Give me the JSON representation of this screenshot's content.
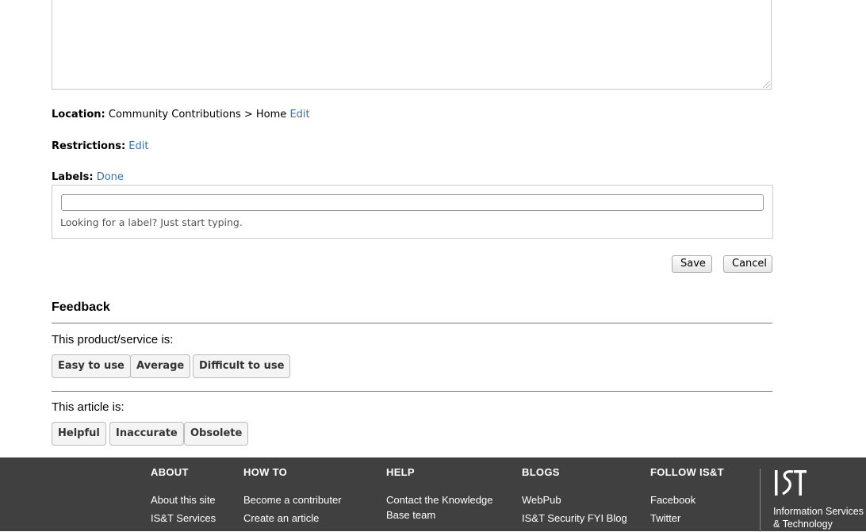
{
  "editor": {
    "location_label": "Location:",
    "location_path": "Community Contributions > Home",
    "location_edit": "Edit",
    "restrictions_label": "Restrictions:",
    "restrictions_edit": "Edit",
    "labels_label": "Labels:",
    "labels_done": "Done",
    "labels_input_value": "",
    "labels_hint": "Looking for a label? Just start typing.",
    "save_label": "Save",
    "cancel_label": "Cancel"
  },
  "feedback": {
    "title": "Feedback",
    "q1": "This product/service is:",
    "q1_options": [
      "Easy to use",
      "Average",
      "Difficult to use"
    ],
    "q2": "This article is:",
    "q2_options": [
      "Helpful",
      "Inaccurate",
      "Obsolete"
    ]
  },
  "footer": {
    "about": {
      "heading": "ABOUT",
      "links": [
        "About this site",
        "IS&T Services"
      ]
    },
    "howto": {
      "heading": "HOW TO",
      "links": [
        "Become a contributer",
        "Create an article"
      ]
    },
    "help": {
      "heading": "HELP",
      "links": [
        "Contact the Knowledge Base team"
      ]
    },
    "blogs": {
      "heading": "BLOGS",
      "links": [
        "WebPub",
        "IS&T Security FYI Blog"
      ]
    },
    "follow": {
      "heading": "FOLLOW IS&T",
      "links": [
        "Facebook",
        "Twitter"
      ]
    },
    "brand_logo": "IST",
    "brand_line1": "Information Services",
    "brand_line2": "& Technology"
  },
  "colors": {
    "link": "#3572b0",
    "footer_bg": "#404040"
  }
}
